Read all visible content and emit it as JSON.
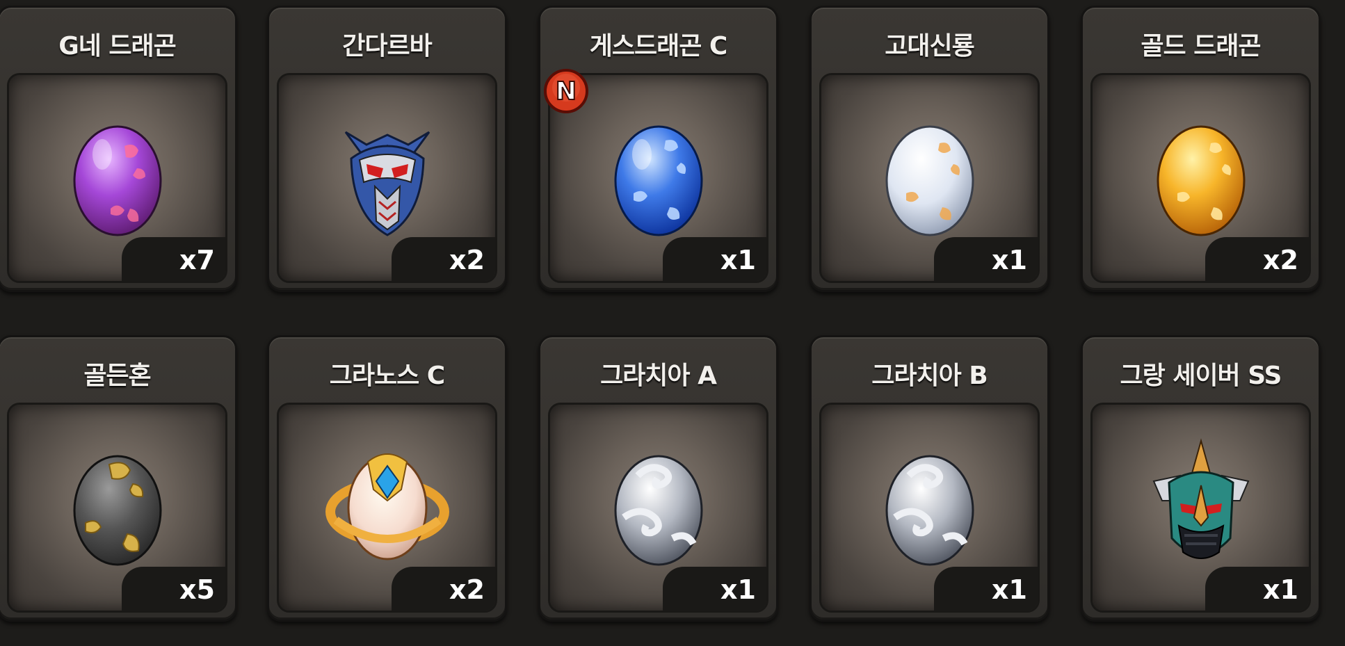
{
  "items": [
    {
      "name": "G네 드래곤",
      "qty": "x7",
      "icon": "purple-egg"
    },
    {
      "name": "간다르바",
      "qty": "x2",
      "icon": "dragon-helmet-blue"
    },
    {
      "name": "게스드래곤 C",
      "qty": "x1",
      "icon": "blue-egg",
      "badge": "N"
    },
    {
      "name": "고대신룡",
      "qty": "x1",
      "icon": "white-egg"
    },
    {
      "name": "골드 드래곤",
      "qty": "x2",
      "icon": "gold-egg"
    },
    {
      "name": "골든혼",
      "qty": "x5",
      "icon": "gray-gold-egg"
    },
    {
      "name": "그라노스 C",
      "qty": "x2",
      "icon": "crystal-ring-egg"
    },
    {
      "name": "그라치아 A",
      "qty": "x1",
      "icon": "silver-swirl-egg"
    },
    {
      "name": "그라치아 B",
      "qty": "x1",
      "icon": "silver-swirl-egg"
    },
    {
      "name": "그랑 세이버 SS",
      "qty": "x1",
      "icon": "dragon-helmet-green"
    }
  ],
  "colors": {
    "background": "#1d1c1a",
    "card": "#34322e",
    "badge": "#d63a1e"
  }
}
